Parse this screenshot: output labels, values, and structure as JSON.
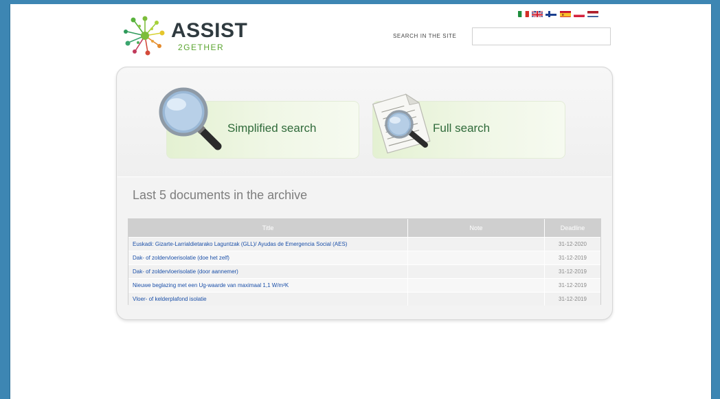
{
  "header": {
    "logo_title": "ASSIST",
    "logo_subtitle": "2GETHER",
    "search_label": "SEARCH IN THE SITE",
    "search_placeholder": "",
    "flags": [
      "italian-flag",
      "uk-flag",
      "finnish-flag",
      "spanish-flag",
      "polish-flag",
      "dutch-flag"
    ]
  },
  "search_options": {
    "simplified_label": "Simplified search",
    "full_label": "Full search"
  },
  "archive": {
    "section_title": "Last 5 documents in the archive",
    "columns": [
      "Title",
      "Note",
      "Deadline"
    ],
    "rows": [
      {
        "title": "Euskadi: Gizarte-Larrialdietarako Laguntzak (GLL)/ Ayudas de Emergencia Social (AES)",
        "note": "",
        "deadline": "31-12-2020"
      },
      {
        "title": "Dak- of zoldervloerisolatie (doe het zelf)",
        "note": "",
        "deadline": "31-12-2019"
      },
      {
        "title": "Dak- of zoldervloerisolatie (door aannemer)",
        "note": "",
        "deadline": "31-12-2019"
      },
      {
        "title": "Nieuwe beglazing met een Ug-waarde van maximaal 1,1 W/m²K",
        "note": "",
        "deadline": "31-12-2019"
      },
      {
        "title": "Vloer- of kelderplafond isolatie",
        "note": "",
        "deadline": "31-12-2019"
      }
    ]
  },
  "colors": {
    "background": "#3d86b3",
    "link": "#1a4fa8",
    "tile_text": "#2f6a3a",
    "logo_green": "#5aa52f"
  }
}
